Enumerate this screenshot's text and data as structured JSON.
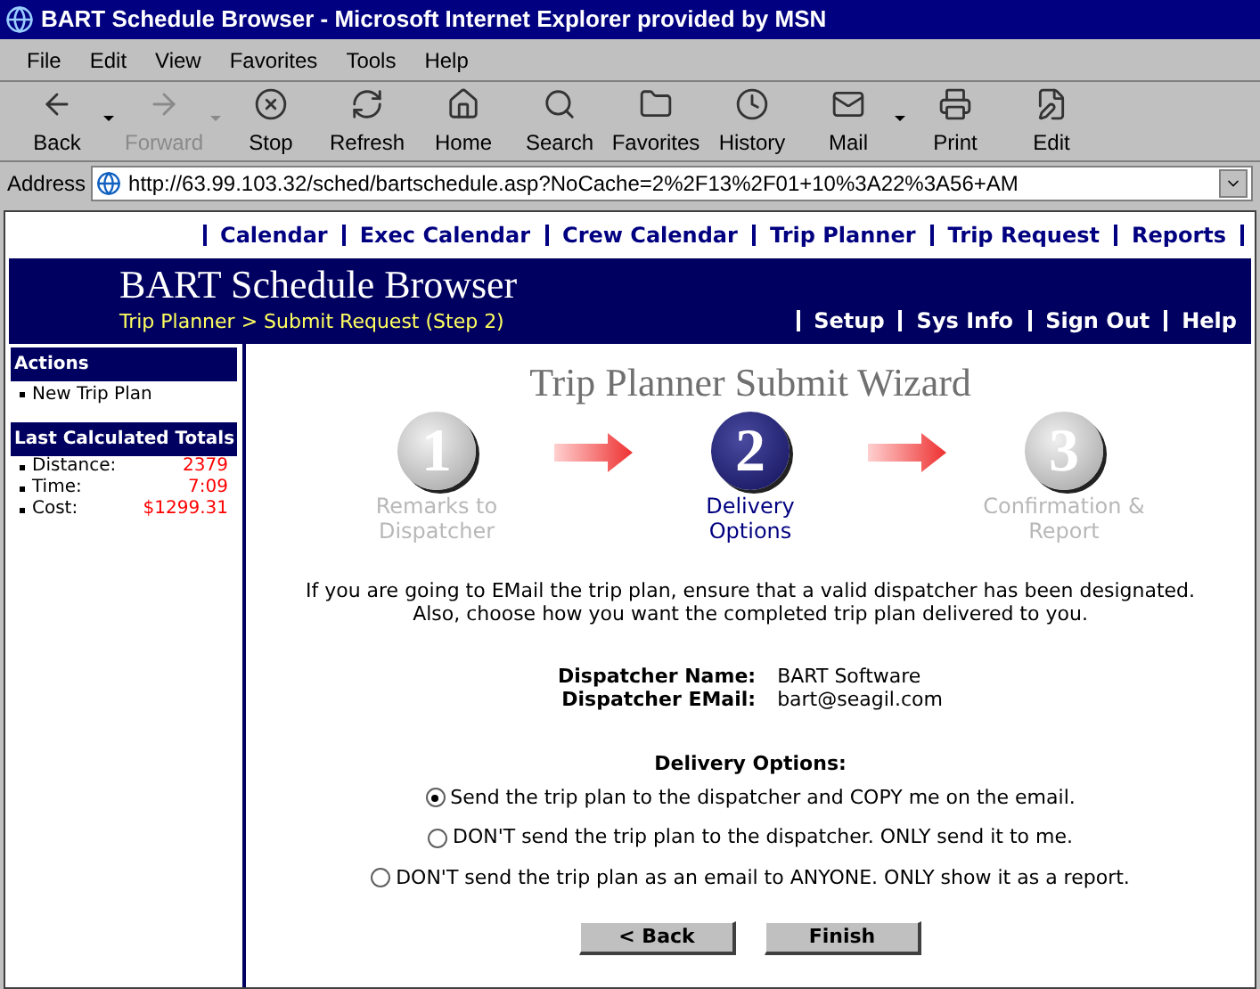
{
  "window": {
    "title": "BART Schedule Browser - Microsoft Internet Explorer provided by MSN"
  },
  "menu": [
    "File",
    "Edit",
    "View",
    "Favorites",
    "Tools",
    "Help"
  ],
  "toolbar": [
    {
      "kind": "back",
      "label": "Back",
      "disabled": false,
      "dropdown": true
    },
    {
      "kind": "forward",
      "label": "Forward",
      "disabled": true,
      "dropdown": true
    },
    {
      "kind": "stop",
      "label": "Stop",
      "disabled": false,
      "dropdown": false
    },
    {
      "kind": "refresh",
      "label": "Refresh",
      "disabled": false,
      "dropdown": false
    },
    {
      "kind": "home",
      "label": "Home",
      "disabled": false,
      "dropdown": false
    },
    {
      "kind": "search",
      "label": "Search",
      "disabled": false,
      "dropdown": false
    },
    {
      "kind": "favorites",
      "label": "Favorites",
      "disabled": false,
      "dropdown": false
    },
    {
      "kind": "history",
      "label": "History",
      "disabled": false,
      "dropdown": false
    },
    {
      "kind": "mail",
      "label": "Mail",
      "disabled": false,
      "dropdown": true
    },
    {
      "kind": "print",
      "label": "Print",
      "disabled": false,
      "dropdown": false
    },
    {
      "kind": "edit",
      "label": "Edit",
      "disabled": false,
      "dropdown": false
    }
  ],
  "address": {
    "label": "Address",
    "value": "http://63.99.103.32/sched/bartschedule.asp?NoCache=2%2F13%2F01+10%3A22%3A56+AM"
  },
  "top_nav": [
    "Calendar",
    "Exec Calendar",
    "Crew Calendar",
    "Trip Planner",
    "Trip Request",
    "Reports"
  ],
  "header": {
    "title": "BART Schedule Browser",
    "breadcrumb": "Trip Planner > Submit Request (Step 2)",
    "links": [
      "Setup",
      "Sys Info",
      "Sign Out",
      "Help"
    ]
  },
  "sidebar": {
    "actions": {
      "title": "Actions",
      "items": [
        "New Trip Plan"
      ]
    },
    "totals": {
      "title": "Last Calculated Totals",
      "rows": [
        {
          "label": "Distance:",
          "value": "2379"
        },
        {
          "label": "Time:",
          "value": "7:09"
        },
        {
          "label": "Cost:",
          "value": "$1299.31"
        }
      ]
    }
  },
  "wizard": {
    "title": "Trip Planner Submit Wizard",
    "steps": [
      {
        "number": "1",
        "label": "Remarks to Dispatcher",
        "selected": false
      },
      {
        "number": "2",
        "label": "Delivery Options",
        "selected": true
      },
      {
        "number": "3",
        "label": "Confirmation & Report",
        "selected": false
      }
    ]
  },
  "instructions": [
    "If you are going to EMail the trip plan, ensure that a valid dispatcher has been designated.",
    "Also, choose how you want the completed trip plan delivered to you."
  ],
  "dispatcher": [
    {
      "label": "Dispatcher Name:",
      "value": "BART Software"
    },
    {
      "label": "Dispatcher EMail:",
      "value": "bart@seagil.com"
    }
  ],
  "delivery": {
    "title": "Delivery Options:",
    "options": [
      {
        "label": "Send the trip plan to the dispatcher and COPY me on the email.",
        "selected": true
      },
      {
        "label": "DON'T send the trip plan to the dispatcher. ONLY send it to me.",
        "selected": false
      },
      {
        "label": "DON'T send the trip plan as an email to ANYONE. ONLY show it as a report.",
        "selected": false
      }
    ]
  },
  "buttons": [
    "< Back",
    "Finish"
  ]
}
